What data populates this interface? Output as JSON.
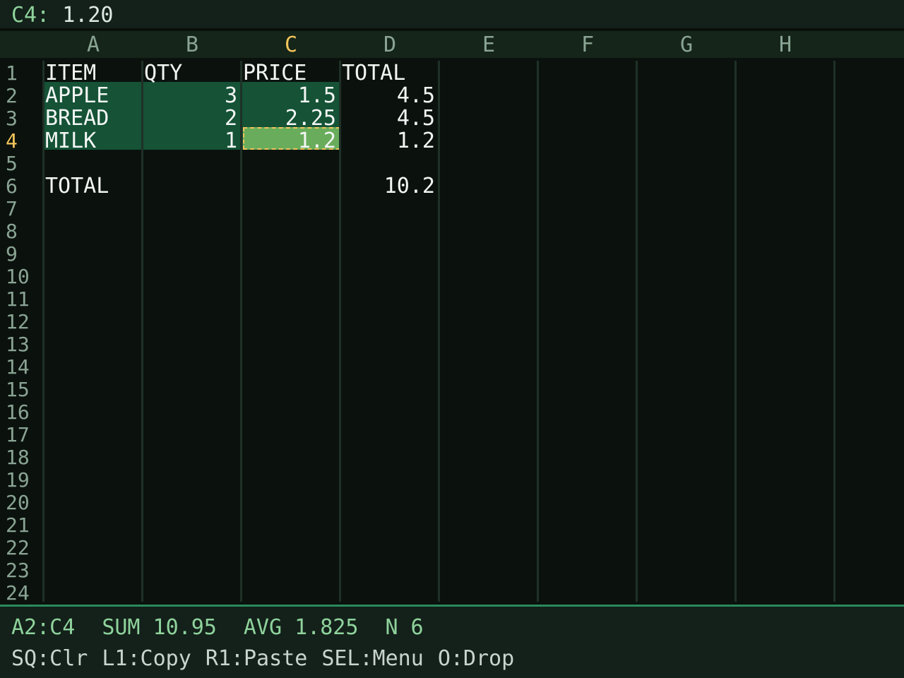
{
  "formula": {
    "ref": "C4:",
    "value": "1.20"
  },
  "columns": [
    "A",
    "B",
    "C",
    "D",
    "E",
    "F",
    "G",
    "H"
  ],
  "active_column": "C",
  "active_row": "4",
  "rows": [
    "1",
    "2",
    "3",
    "4",
    "5",
    "6",
    "7",
    "8",
    "9",
    "10",
    "11",
    "12",
    "13",
    "14",
    "15",
    "16",
    "17",
    "18",
    "19",
    "20",
    "21",
    "22",
    "23",
    "24"
  ],
  "sheet": {
    "header": {
      "item": "ITEM",
      "qty": "QTY",
      "price": "PRICE",
      "total": "TOTAL"
    },
    "items": [
      {
        "item": "APPLE",
        "qty": "3",
        "price": "1.5",
        "total": "4.5"
      },
      {
        "item": "BREAD",
        "qty": "2",
        "price": "2.25",
        "total": "4.5"
      },
      {
        "item": "MILK",
        "qty": "1",
        "price": "1.2",
        "total": "1.2"
      }
    ],
    "summary": {
      "label": "TOTAL",
      "value": "10.2"
    }
  },
  "status": {
    "range": "A2:C4",
    "sum": "SUM 10.95",
    "avg": "AVG 1.825",
    "count": "N 6"
  },
  "hints": {
    "clear": "SQ:Clr",
    "copy": "L1:Copy",
    "paste": "R1:Paste",
    "menu": "SEL:Menu",
    "drop": "O:Drop"
  },
  "colors": {
    "background": "#0b120e",
    "selection": "#155236",
    "active_cell": "#69ad5c",
    "accent": "#f2c45a",
    "status_text": "#8fd39c"
  }
}
